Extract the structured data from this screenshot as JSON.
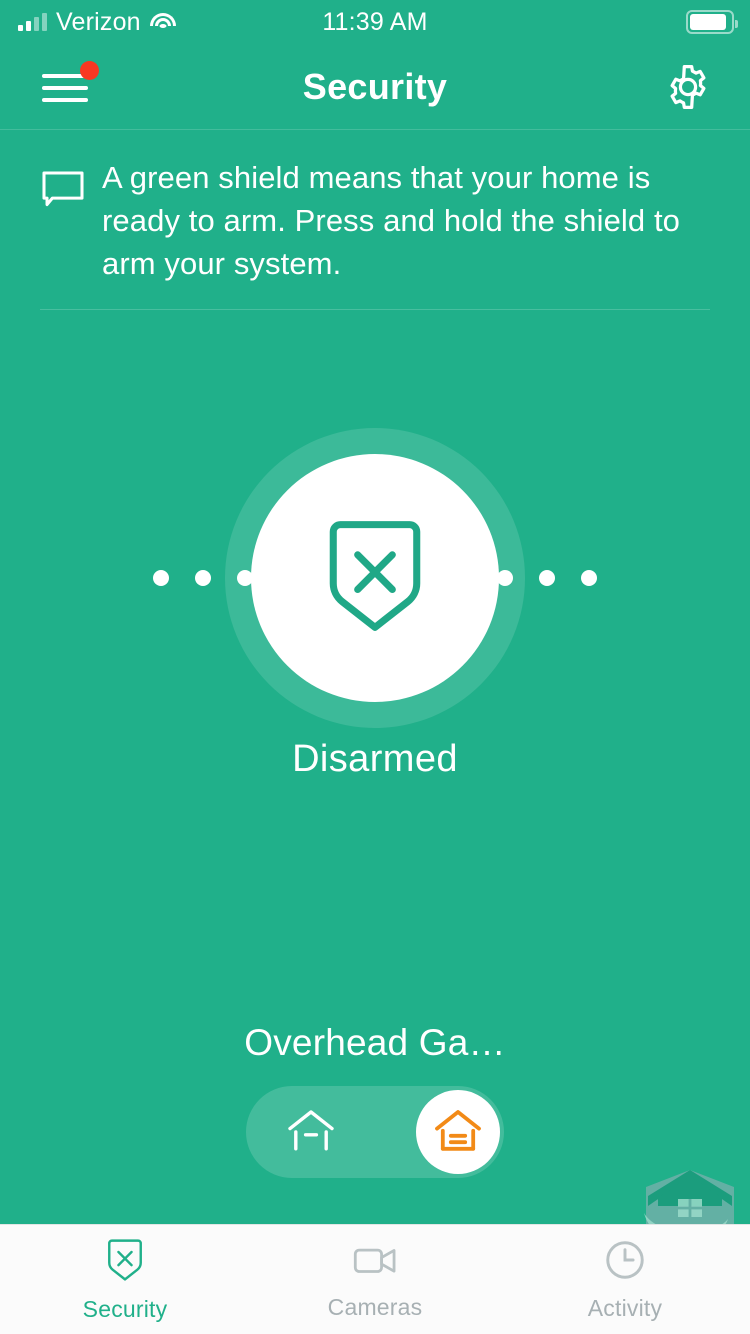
{
  "statusbar": {
    "carrier": "Verizon",
    "time": "11:39 AM",
    "signal_icon": "cellular-signal-icon",
    "wifi_icon": "wifi-icon",
    "battery_icon": "battery-icon"
  },
  "header": {
    "title": "Security",
    "menu_icon": "hamburger-menu-icon",
    "notification_badge": "notification-dot",
    "settings_icon": "gear-icon"
  },
  "banner": {
    "icon": "speech-bubble-icon",
    "message": "A green shield means that your home is ready to arm. Press and hold the shield to arm your system."
  },
  "main": {
    "shield_icon": "shield-x-icon",
    "status": "Disarmed",
    "dots_left": [
      "dot",
      "dot",
      "dot"
    ],
    "dots_right": [
      "dot",
      "dot",
      "dot"
    ]
  },
  "device": {
    "name": "Overhead Ga…",
    "open_icon": "garage-open-icon",
    "closed_icon": "garage-closed-icon",
    "selected": "closed"
  },
  "tabs": [
    {
      "label": "Security",
      "icon": "shield-x-icon",
      "active": true
    },
    {
      "label": "Cameras",
      "icon": "video-camera-icon",
      "active": false
    },
    {
      "label": "Activity",
      "icon": "clock-icon",
      "active": false
    }
  ],
  "watermark": {
    "icon": "house-shield-logo"
  },
  "colors": {
    "brand_green": "#20b08a",
    "accent_orange": "#f28a17",
    "badge_red": "#f93822",
    "tab_inactive": "#a7b0b3",
    "tabbar_bg": "#fbfbfb"
  }
}
